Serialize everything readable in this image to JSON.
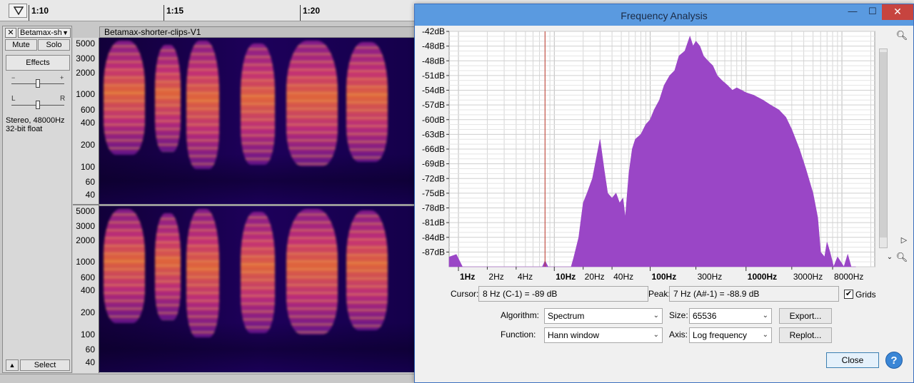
{
  "timeline": {
    "labels": [
      "1:10",
      "1:15",
      "1:20"
    ]
  },
  "track": {
    "name": "Betamax-sh",
    "mute_label": "Mute",
    "solo_label": "Solo",
    "effects_label": "Effects",
    "gain_minus": "−",
    "gain_plus": "+",
    "pan_left": "L",
    "pan_right": "R",
    "info": "Stereo, 48000Hz\n32-bit float",
    "select_label": "Select",
    "close_glyph": "✕",
    "clip_name": "Betamax-shorter-clips-V1"
  },
  "vruler": {
    "labels": [
      "5000",
      "3000",
      "2000",
      "1000",
      "600",
      "400",
      "200",
      "100",
      "60",
      "40"
    ]
  },
  "freq_window": {
    "title": "Frequency Analysis",
    "cursor_label": "Cursor:",
    "cursor_value": "8 Hz (C-1) = -89 dB",
    "peak_label": "Peak:",
    "peak_value": "7 Hz (A#-1) = -88.9 dB",
    "grids_label": "Grids",
    "grids_checked": true,
    "algorithm_label": "Algorithm:",
    "algorithm_value": "Spectrum",
    "size_label": "Size:",
    "size_value": "65536",
    "function_label": "Function:",
    "function_value": "Hann window",
    "axis_label": "Axis:",
    "axis_value": "Log frequency",
    "export_label": "Export...",
    "replot_label": "Replot...",
    "close_label": "Close",
    "help_glyph": "?",
    "window_minimize": "—",
    "window_maximize": "☐",
    "window_close": "✕"
  },
  "chart_data": {
    "type": "area",
    "title": "",
    "xlabel": "",
    "ylabel": "",
    "x_scale": "log",
    "x_ticks": [
      "1Hz",
      "2Hz",
      "4Hz",
      "10Hz",
      "20Hz",
      "40Hz",
      "100Hz",
      "300Hz",
      "1000Hz",
      "3000Hz",
      "8000Hz"
    ],
    "x_tick_values": [
      1,
      2,
      4,
      10,
      20,
      40,
      100,
      300,
      1000,
      3000,
      8000
    ],
    "xlim": [
      0.8,
      22000
    ],
    "y_ticks": [
      "-42dB",
      "-48dB",
      "-48dB",
      "-51dB",
      "-54dB",
      "-57dB",
      "-60dB",
      "-63dB",
      "-66dB",
      "-69dB",
      "-72dB",
      "-75dB",
      "-78dB",
      "-81dB",
      "-84dB",
      "-87dB"
    ],
    "ylim": [
      -90,
      -42
    ],
    "grid": true,
    "fill_color": "#9a46c6",
    "cursor_line_hz": 8,
    "series": [
      {
        "x": [
          0.8,
          0.95,
          1.1,
          7.5,
          8,
          8.6,
          15,
          16,
          18,
          20,
          22,
          25,
          28,
          30,
          33,
          36,
          40,
          44,
          48,
          52,
          55,
          60,
          65,
          70,
          80,
          90,
          100,
          110,
          125,
          140,
          160,
          180,
          200,
          230,
          260,
          280,
          300,
          330,
          360,
          400,
          450,
          500,
          560,
          640,
          720,
          800,
          900,
          1000,
          1200,
          1500,
          1800,
          2200,
          2600,
          3000,
          3600,
          4200,
          5000,
          5600,
          6000,
          6600,
          7000,
          7500,
          8200,
          9000,
          10500,
          11500,
          12500,
          14000
        ],
        "y": [
          -88,
          -87.5,
          -90,
          -90,
          -88.8,
          -90,
          -90,
          -88,
          -84,
          -77,
          -75,
          -72,
          -67,
          -64,
          -70,
          -75,
          -76,
          -75,
          -77,
          -76,
          -80,
          -71,
          -66,
          -64,
          -63,
          -61,
          -60,
          -58,
          -56,
          -53,
          -51,
          -50,
          -47,
          -46,
          -43,
          -45,
          -44,
          -45,
          -47,
          -48,
          -49,
          -51,
          -52,
          -53,
          -54,
          -53.5,
          -54,
          -54.5,
          -55,
          -56,
          -57,
          -58,
          -59.5,
          -62,
          -66,
          -70,
          -75,
          -80,
          -87,
          -88,
          -85,
          -87,
          -90,
          -88,
          -90,
          -87.5,
          -90,
          -90
        ]
      }
    ]
  }
}
